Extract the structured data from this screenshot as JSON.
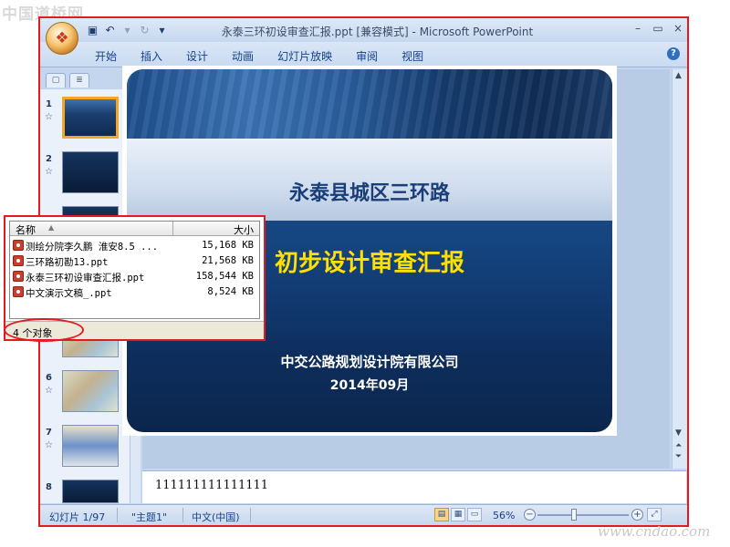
{
  "watermark": {
    "top": "中国道桥网",
    "bottom": "www.cndao.com"
  },
  "window": {
    "title": "永泰三环初设审查汇报.ppt [兼容模式] - Microsoft PowerPoint",
    "controls": [
      "–",
      "▭",
      "×"
    ]
  },
  "quick_access": {
    "save": "save-icon",
    "undo": "undo-icon",
    "redo": "redo-icon",
    "more": "customize-icon"
  },
  "ribbon": {
    "tabs": [
      "开始",
      "插入",
      "设计",
      "动画",
      "幻灯片放映",
      "审阅",
      "视图"
    ],
    "help": "?"
  },
  "left_pane": {
    "close": "×",
    "thumbnails": [
      {
        "number": "1",
        "style": "sel"
      },
      {
        "number": "2",
        "style": "dark"
      },
      {
        "number": "6",
        "style": "map"
      },
      {
        "number": "7",
        "style": "map2"
      },
      {
        "number": "8",
        "style": "dark"
      }
    ]
  },
  "slide": {
    "title": "永泰县城区三环路",
    "subtitle": "初步设计审查汇报",
    "organization": "中交公路规划设计院有限公司",
    "date": "2014年09月"
  },
  "notes": {
    "text": "111111111111111"
  },
  "status_bar": {
    "slide_indicator": "幻灯片 1/97",
    "theme": "\"主题1\"",
    "language": "中文(中国)",
    "zoom": "56%",
    "zoom_fraction": 0.4
  },
  "file_list": {
    "headers": {
      "name": "名称",
      "size": "大小"
    },
    "files": [
      {
        "name": "测绘分院李久鹏 淮安8.5 ...",
        "size": "15,168 KB"
      },
      {
        "name": "三环路初勘13.ppt",
        "size": "21,568 KB"
      },
      {
        "name": "永泰三环初设审查汇报.ppt",
        "size": "158,544 KB"
      },
      {
        "name": "中文演示文稿_.ppt",
        "size": "8,524 KB"
      }
    ],
    "status": "4 个对象"
  }
}
